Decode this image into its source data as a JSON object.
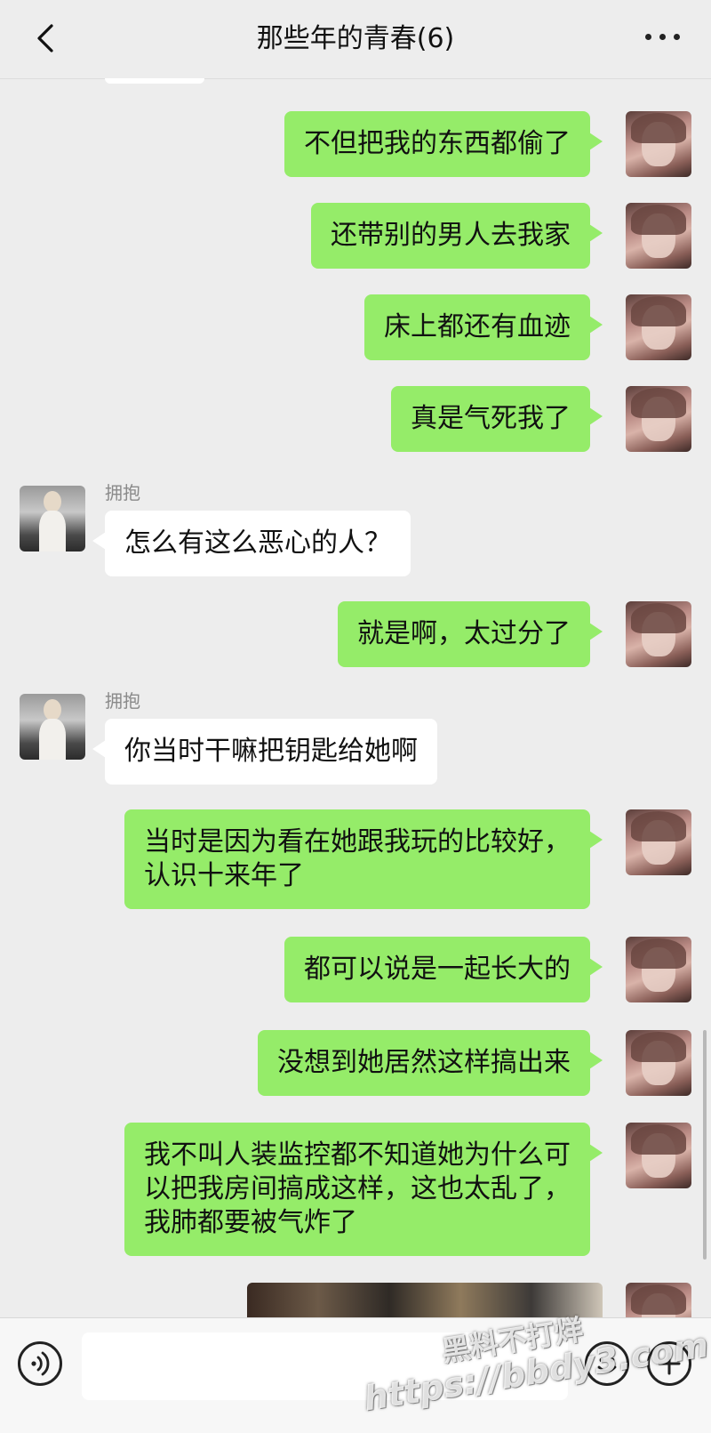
{
  "header": {
    "title": "那些年的青春(6)"
  },
  "messages": [
    {
      "side": "right",
      "text": "不但把我的东西都偷了"
    },
    {
      "side": "right",
      "text": "还带别的男人去我家"
    },
    {
      "side": "right",
      "text": "床上都还有血迹"
    },
    {
      "side": "right",
      "text": "真是气死我了"
    },
    {
      "side": "left",
      "sender": "拥抱",
      "text": "怎么有这么恶心的人？"
    },
    {
      "side": "right",
      "text": "就是啊，太过分了"
    },
    {
      "side": "left",
      "sender": "拥抱",
      "text": "你当时干嘛把钥匙给她啊"
    },
    {
      "side": "right",
      "text": "当时是因为看在她跟我玩的比较好，\n认识十来年了"
    },
    {
      "side": "right",
      "text": "都可以说是一起长大的"
    },
    {
      "side": "right",
      "text": "没想到她居然这样搞出来"
    },
    {
      "side": "right",
      "text": "我不叫人装监控都不知道她为什么可\n以把我房间搞成这样，这也太乱了，\n我肺都要被气炸了"
    }
  ],
  "footer": {
    "input_value": ""
  },
  "watermark": {
    "line1": "黑料不打烊",
    "line2": "https://bbdy3.com"
  },
  "icons": {
    "back": "chevron-left-icon",
    "more": "more-dots-icon",
    "voice": "voice-icon",
    "emoji": "emoji-icon",
    "plus": "plus-icon"
  },
  "colors": {
    "background": "#ededed",
    "outgoing_bubble": "#95ec69",
    "incoming_bubble": "#ffffff"
  }
}
